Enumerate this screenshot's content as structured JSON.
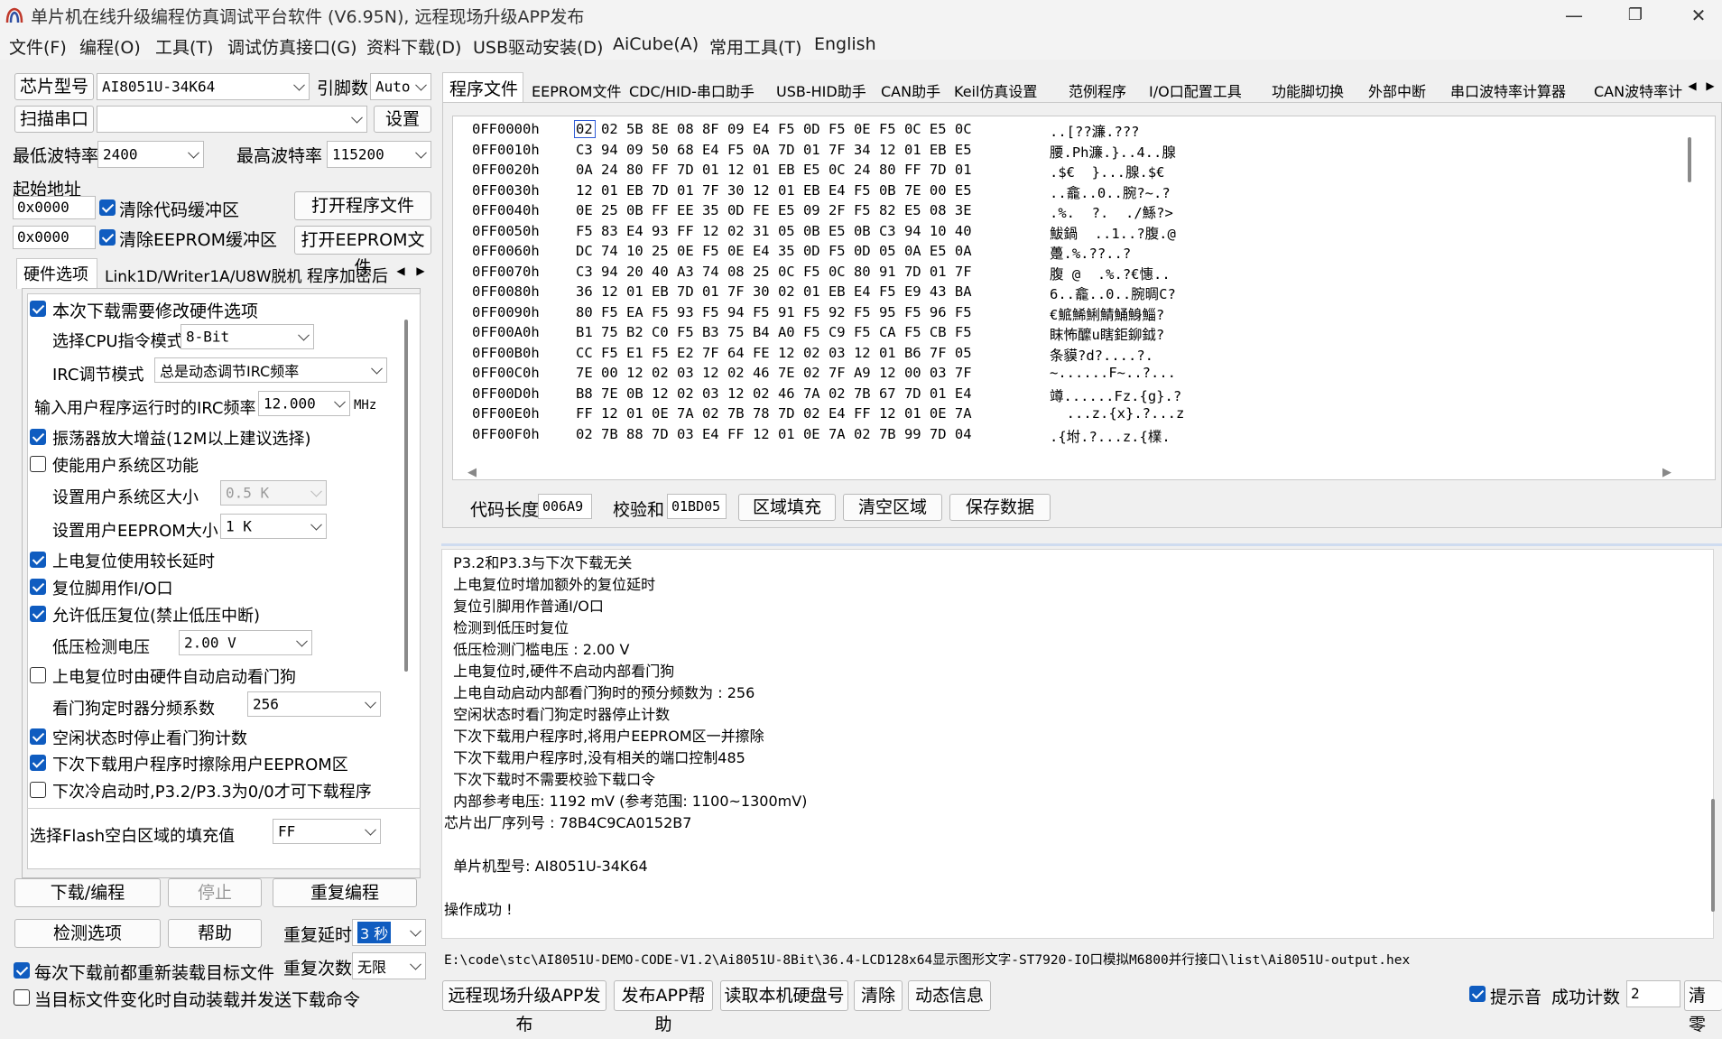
{
  "window": {
    "title": "单片机在线升级编程仿真调试平台软件 (V6.95N), 远程现场升级APP发布",
    "min": "—",
    "max": "❐",
    "close": "✕"
  },
  "menu": [
    "文件(F)",
    "编程(O)",
    "工具(T)",
    "调试仿真接口(G)",
    "资料下载(D)",
    "USB驱动安装(D)",
    "AiCube(A)",
    "常用工具(T)",
    "English"
  ],
  "left": {
    "chip_model_btn": "芯片型号",
    "chip_model": "AI8051U-34K64",
    "pin_count_label": "引脚数",
    "pin_count": "Auto",
    "scan_port_btn": "扫描串口",
    "port_value": "",
    "settings_btn": "设置",
    "min_baud_label": "最低波特率",
    "min_baud": "2400",
    "max_baud_label": "最高波特率",
    "max_baud": "115200",
    "start_addr_label": "起始地址",
    "addr1": "0x0000",
    "clear_code_buf": "清除代码缓冲区",
    "open_prog_btn": "打开程序文件",
    "addr2": "0x0000",
    "clear_eeprom_buf": "清除EEPROM缓冲区",
    "open_eeprom_btn": "打开EEPROM文件",
    "tabs": [
      "硬件选项",
      "Link1D/Writer1A/U8W脱机",
      "程序加密后"
    ],
    "opts": {
      "modify_hw": "本次下载需要修改硬件选项",
      "cpu_mode_label": "选择CPU指令模式",
      "cpu_mode": "8-Bit",
      "irc_mode_label": "IRC调节模式",
      "irc_mode": "总是动态调节IRC频率",
      "irc_freq_label": "输入用户程序运行时的IRC频率",
      "irc_freq": "12.000",
      "irc_unit": "MHz",
      "osc_gain": "振荡器放大增益(12M以上建议选择)",
      "enable_sys": "使能用户系统区功能",
      "sys_size_label": "设置用户系统区大小",
      "sys_size": "0.5 K",
      "eeprom_size_label": "设置用户EEPROM大小",
      "eeprom_size": "1   K",
      "long_delay": "上电复位使用较长延时",
      "reset_io": "复位脚用作I/O口",
      "lvr": "允许低压复位(禁止低压中断)",
      "lvd_label": "低压检测电压",
      "lvd": "2.00 V",
      "wdt_auto": "上电复位时由硬件自动启动看门狗",
      "wdt_div_label": "看门狗定时器分频系数",
      "wdt_div": "256",
      "idle_stop_wdt": "空闲状态时停止看门狗计数",
      "erase_eeprom": "下次下载用户程序时擦除用户EEPROM区",
      "p32_p33": "下次冷启动时,P3.2/P3.3为0/0才可下载程序",
      "flash_fill_label": "选择Flash空白区域的填充值",
      "flash_fill": "FF"
    },
    "download_btn": "下载/编程",
    "stop_btn": "停止",
    "reprog_btn": "重复编程",
    "check_btn": "检测选项",
    "help_btn": "帮助",
    "repeat_delay_label": "重复延时",
    "repeat_delay": "3 秒",
    "repeat_count_label": "重复次数",
    "repeat_count": "无限",
    "reload_each": "每次下载前都重新装载目标文件",
    "auto_send": "当目标文件变化时自动装载并发送下载命令"
  },
  "right_tabs": [
    "程序文件",
    "EEPROM文件",
    "CDC/HID-串口助手",
    "USB-HID助手",
    "CAN助手",
    "Keil仿真设置",
    "范例程序",
    "I/O口配置工具",
    "功能脚切换",
    "外部中断",
    "串口波特率计算器",
    "CAN波特率计"
  ],
  "hex": [
    {
      "a": "0FF0000h",
      "b": "02 02 5B 8E 08 8F 09 E4 F5 0D F5 0E F5 0C E5 0C",
      "t": "..[??濂.???"
    },
    {
      "a": "0FF0010h",
      "b": "C3 94 09 50 68 E4 F5 0A 7D 01 7F 34 12 01 EB E5",
      "t": "腰.Ph濂.}..4..腺"
    },
    {
      "a": "0FF0020h",
      "b": "0A 24 80 FF 7D 01 12 01 EB E5 0C 24 80 FF 7D 01",
      "t": ".$€  }...腺.$€"
    },
    {
      "a": "0FF0030h",
      "b": "12 01 EB 7D 01 7F 30 12 01 EB E4 F5 0B 7E 00 E5",
      "t": "..龕..0..腕?~.?"
    },
    {
      "a": "0FF0040h",
      "b": "0E 25 0B FF EE 35 0D FE E5 09 2F F5 82 E5 08 3E",
      "t": ".%.  ?.  ./鯀?>"
    },
    {
      "a": "0FF0050h",
      "b": "F5 83 E4 93 FF 12 02 31 05 0B E5 0B C3 94 10 40",
      "t": "鮁鍋  ..1..?腹.@"
    },
    {
      "a": "0FF0060h",
      "b": "DC 74 10 25 0E F5 0E E4 35 0D F5 0D 05 0A E5 0A",
      "t": "躉.%.??..?"
    },
    {
      "a": "0FF0070h",
      "b": "C3 94 20 40 A3 74 08 25 0C F5 0C 80 91 7D 01 7F",
      "t": "腹 @  .%.?€憓.."
    },
    {
      "a": "0FF0080h",
      "b": "36 12 01 EB 7D 01 7F 30 02 01 EB E4 F5 E9 43 BA",
      "t": "6..龕..0..腕晭C?"
    },
    {
      "a": "0FF0090h",
      "b": "80 F5 EA F5 93 F5 94 F5 91 F5 92 F5 95 F5 96 F5",
      "t": "€鯳鯑鯏鯖鯒鯓鯔?"
    },
    {
      "a": "0FF00A0h",
      "b": "B1 75 B2 C0 F5 B3 75 B4 A0 F5 C9 F5 CA F5 CB F5",
      "t": "眜怖醿u瞎鉅鉚鉞?"
    },
    {
      "a": "0FF00B0h",
      "b": "CC F5 E1 F5 E2 7F 64 FE 12 02 03 12 01 B6 7F 05",
      "t": "条貘?d?....?."
    },
    {
      "a": "0FF00C0h",
      "b": "7E 00 12 02 03 12 02 46 7E 02 7F A9 12 00 03 7F",
      "t": "~......F~..?..."
    },
    {
      "a": "0FF00D0h",
      "b": "B8 7E 0B 12 02 03 12 02 46 7A 02 7B 67 7D 01 E4",
      "t": "竴......Fz.{g}.?"
    },
    {
      "a": "0FF00E0h",
      "b": "FF 12 01 0E 7A 02 7B 78 7D 02 E4 FF 12 01 0E 7A",
      "t": "  ...z.{x}.?...z"
    },
    {
      "a": "0FF00F0h",
      "b": "02 7B 88 7D 03 E4 FF 12 01 0E 7A 02 7B 99 7D 04",
      "t": ".{坿.?...z.{檏."
    }
  ],
  "hexinfo": {
    "code_len_label": "代码长度",
    "code_len": "006A9",
    "checksum_label": "校验和",
    "checksum": "01BD05",
    "fill_btn": "区域填充",
    "clear_btn": "清空区域",
    "save_btn": "保存数据"
  },
  "log": [
    "  P3.2和P3.3与下次下载无关",
    "  上电复位时增加额外的复位延时",
    "  复位引脚用作普通I/O口",
    "  检测到低压时复位",
    "  低压检测门槛电压 : 2.00 V",
    "  上电复位时,硬件不启动内部看门狗",
    "  上电自动启动内部看门狗时的预分频数为 : 256",
    "  空闲状态时看门狗定时器停止计数",
    "  下次下载用户程序时,将用户EEPROM区一并擦除",
    "  下次下载用户程序时,没有相关的端口控制485",
    "  下次下载时不需要校验下载口令",
    "  内部参考电压: 1192 mV (参考范围: 1100~1300mV)",
    "芯片出厂序列号 : 78B4C9CA0152B7",
    "",
    "  单片机型号: AI8051U-34K64",
    "",
    "操作成功 !"
  ],
  "file_path": "E:\\code\\stc\\AI8051U-DEMO-CODE-V1.2\\Ai8051U-8Bit\\36.4-LCD128x64显示图形文字-ST7920-IO口模拟M6800并行接口\\list\\Ai8051U-output.hex",
  "bottom": {
    "remote_btn": "远程现场升级APP发布",
    "publish_help_btn": "发布APP帮助",
    "read_disk_btn": "读取本机硬盘号",
    "clear_btn": "清除",
    "dyn_info_btn": "动态信息",
    "sound_label": "提示音",
    "success_label": "成功计数",
    "success_count": "2",
    "reset_btn": "清零"
  }
}
